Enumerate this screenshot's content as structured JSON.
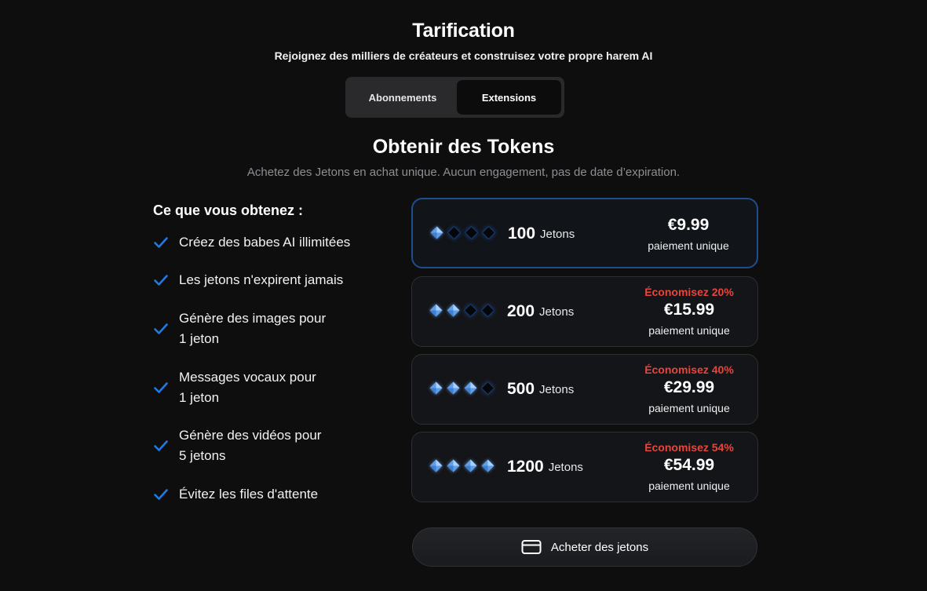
{
  "header": {
    "title": "Tarification",
    "subtitle": "Rejoignez des milliers de créateurs et construisez votre propre harem AI"
  },
  "tabs": [
    {
      "label": "Abonnements",
      "active": false
    },
    {
      "label": "Extensions",
      "active": true
    }
  ],
  "section": {
    "title": "Obtenir des Tokens",
    "subtitle": "Achetez des Jetons en achat unique. Aucun engagement, pas de date d’expiration."
  },
  "features": {
    "heading": "Ce que vous obtenez :",
    "items": [
      {
        "line1": "Créez des babes AI illimitées",
        "line2": ""
      },
      {
        "line1": "Les jetons n'expirent jamais",
        "line2": ""
      },
      {
        "line1": "Génère des images pour",
        "line2": "1 jeton"
      },
      {
        "line1": "Messages vocaux pour",
        "line2": "1 jeton"
      },
      {
        "line1": "Génère des vidéos pour",
        "line2": "5 jetons"
      },
      {
        "line1": "Évitez les files d'attente",
        "line2": ""
      }
    ]
  },
  "packs": [
    {
      "amount": "100",
      "unit": "Jetons",
      "price": "€9.99",
      "payment": "paiement unique",
      "savings": "",
      "gems_lit": 1,
      "selected": true
    },
    {
      "amount": "200",
      "unit": "Jetons",
      "price": "€15.99",
      "payment": "paiement unique",
      "savings": "Économisez 20%",
      "gems_lit": 2,
      "selected": false
    },
    {
      "amount": "500",
      "unit": "Jetons",
      "price": "€29.99",
      "payment": "paiement unique",
      "savings": "Économisez 40%",
      "gems_lit": 3,
      "selected": false
    },
    {
      "amount": "1200",
      "unit": "Jetons",
      "price": "€54.99",
      "payment": "paiement unique",
      "savings": "Économisez 54%",
      "gems_lit": 4,
      "selected": false
    }
  ],
  "buy_button": {
    "label": "Acheter des jetons",
    "icon": "credit-card-icon"
  },
  "colors": {
    "background": "#0e0e0f",
    "accent_blue": "#1f7ae6",
    "savings_red": "#e8453c",
    "gem_lit": "#7fb6f5",
    "selected_border": "#1f4e8c"
  }
}
